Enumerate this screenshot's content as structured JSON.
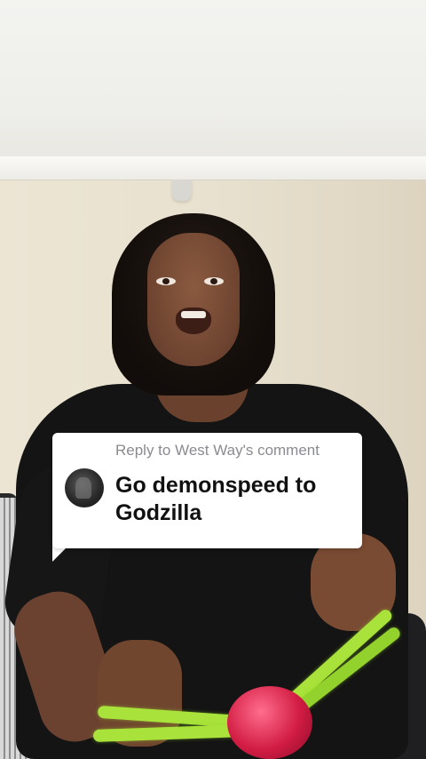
{
  "reply_sticker": {
    "header": "Reply to West Way's comment",
    "comment_text": "Go demonspeed to Godzilla",
    "avatar_icon": "commenter-avatar"
  },
  "colors": {
    "sticker_background": "#ffffff",
    "header_text": "#8a8b91",
    "comment_text": "#111111",
    "toy_band": "#a8e23a",
    "toy_ball": "#d21c43"
  }
}
